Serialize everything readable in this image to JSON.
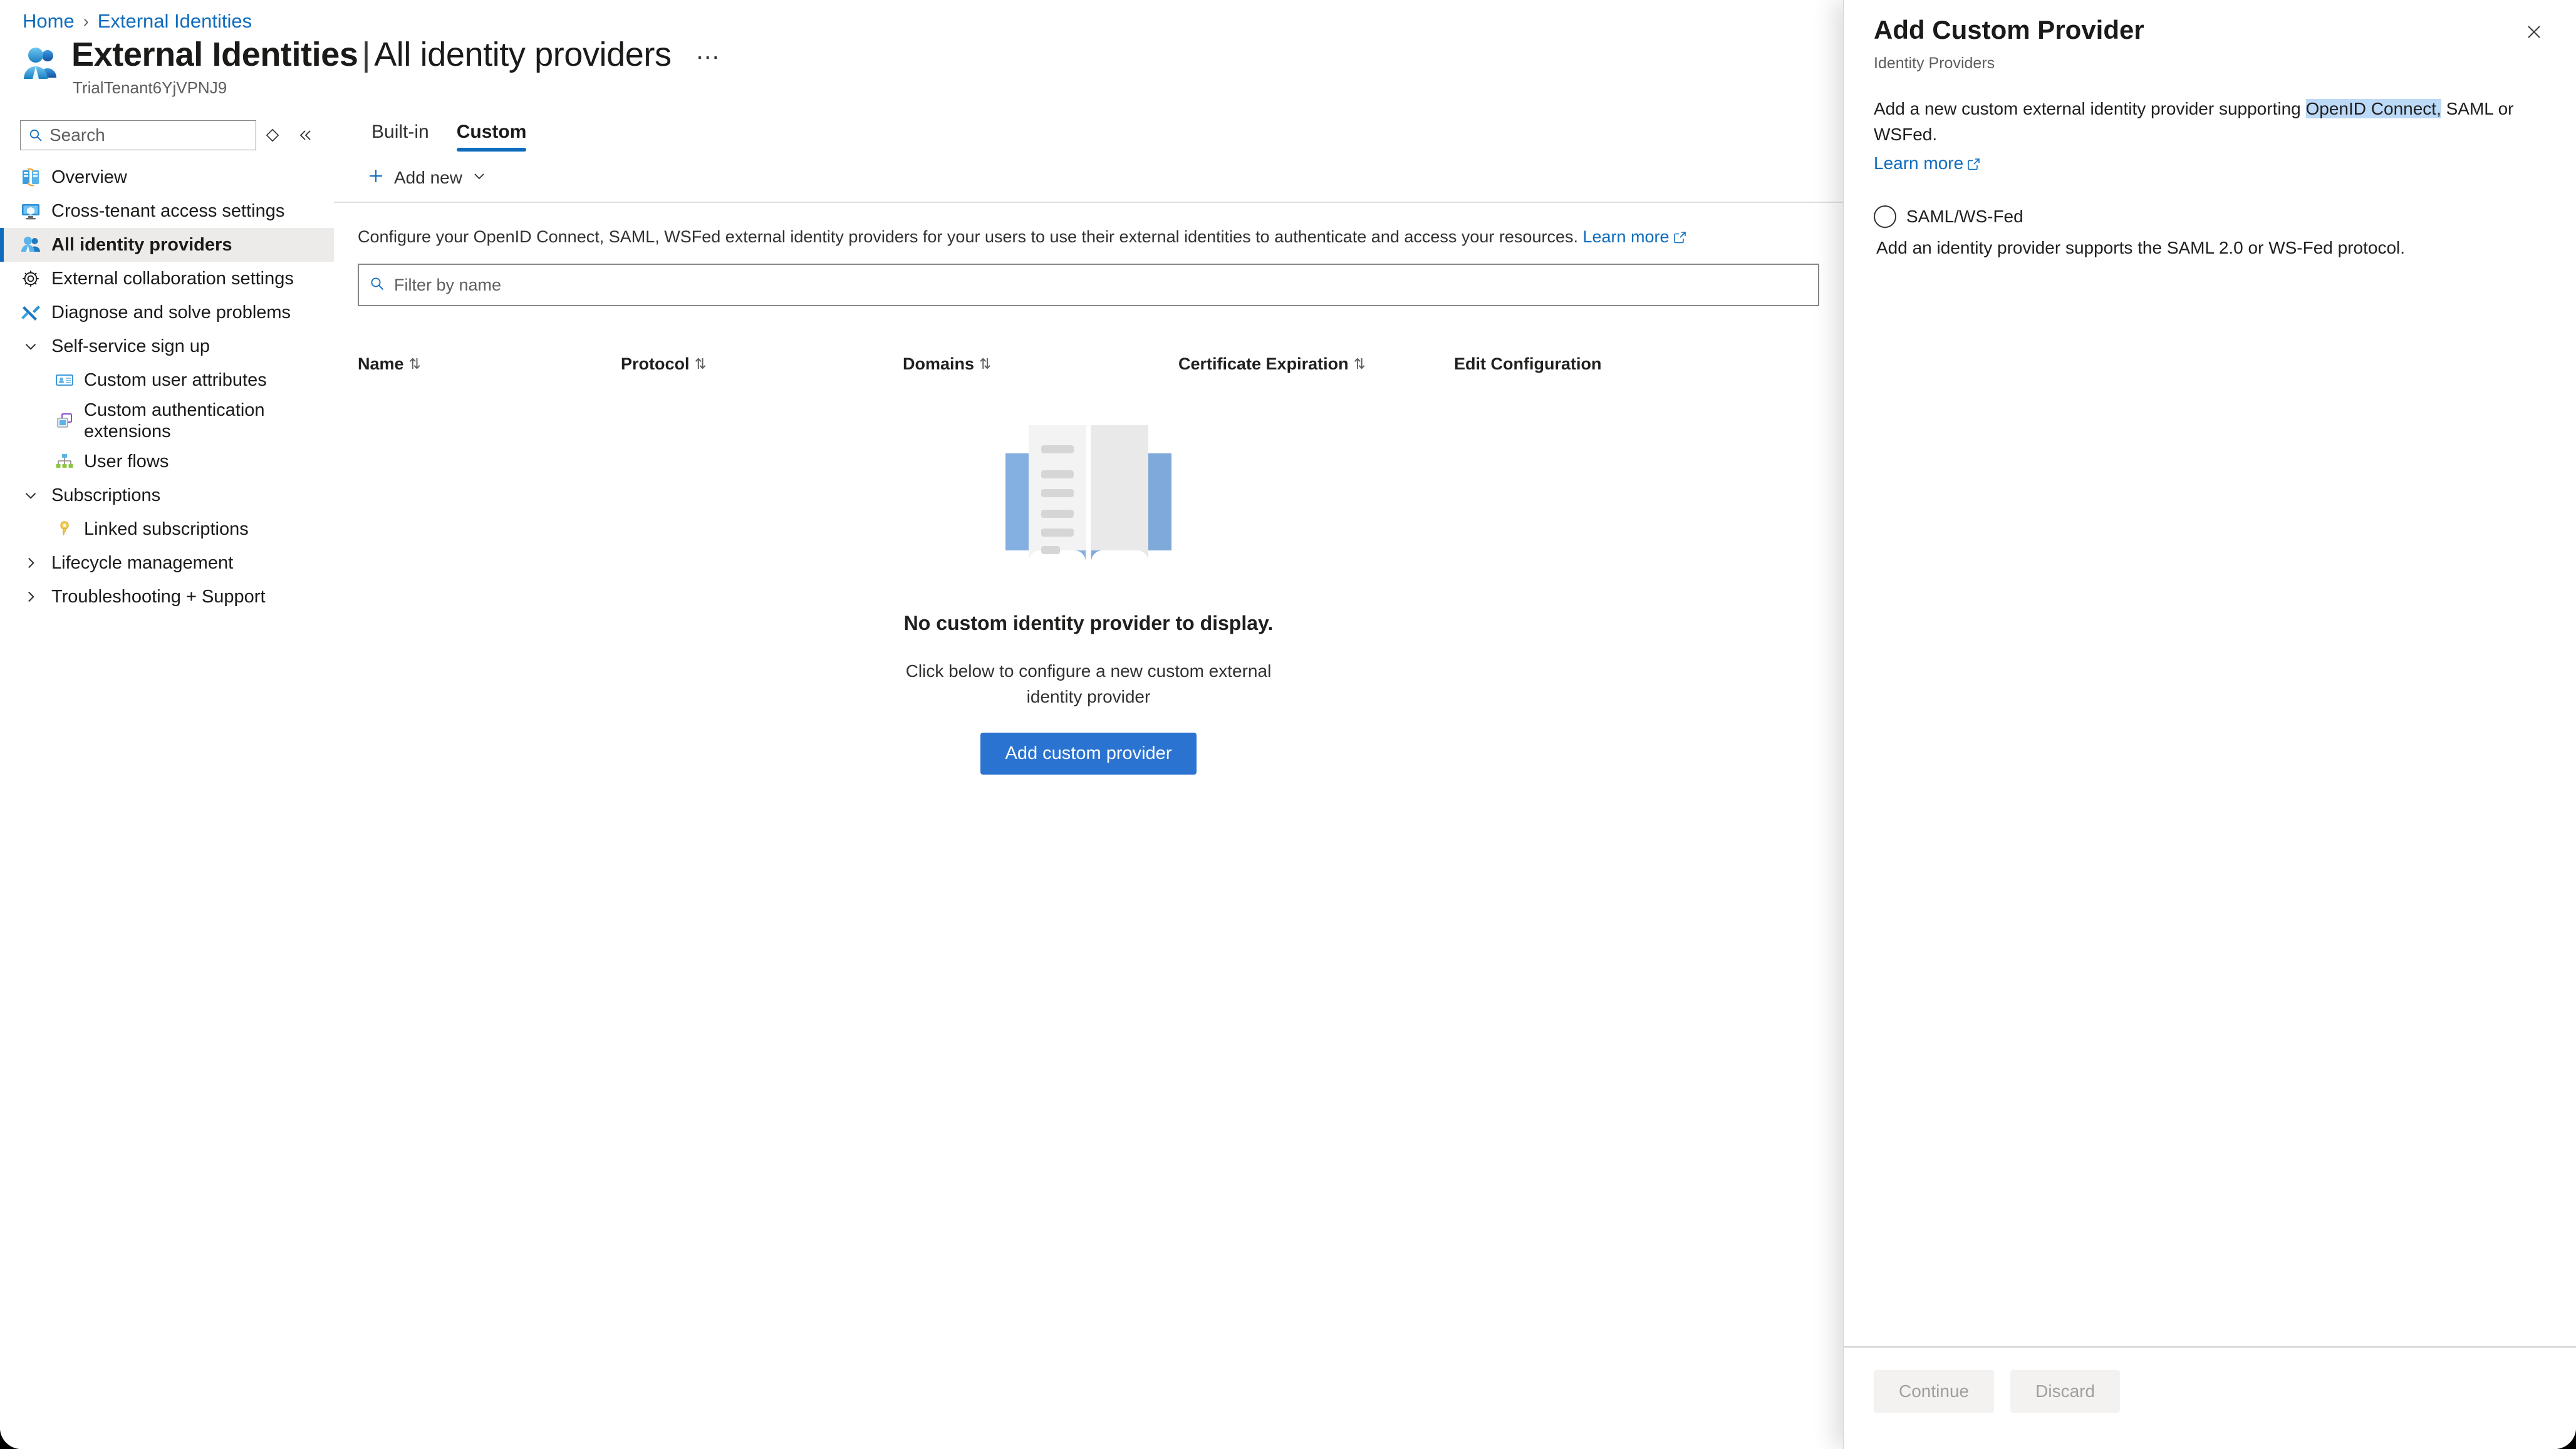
{
  "breadcrumb": {
    "home": "Home",
    "separator": "›",
    "current": "External Identities"
  },
  "header": {
    "icon": "external-identities-icon",
    "title_main": "External Identities",
    "title_divider": "|",
    "title_sub": "All identity providers",
    "more_label": "…",
    "tenant": "TrialTenant6YjVPNJ9"
  },
  "sidebar": {
    "search_placeholder": "Search",
    "search_value": "",
    "diamond_icon": "pin-diamond-icon",
    "collapse_icon": "collapse-double-chevron-icon",
    "items": [
      {
        "label": "Overview",
        "icon": "overview-icon",
        "level": 0,
        "selected": false
      },
      {
        "label": "Cross-tenant access settings",
        "icon": "monitor-icon",
        "level": 0,
        "selected": false
      },
      {
        "label": "All identity providers",
        "icon": "identity-providers-icon",
        "level": 0,
        "selected": true
      },
      {
        "label": "External collaboration settings",
        "icon": "gear-icon",
        "level": 0,
        "selected": false
      },
      {
        "label": "Diagnose and solve problems",
        "icon": "wrench-screwdriver-icon",
        "level": 0,
        "selected": false
      },
      {
        "label": "Self-service sign up",
        "icon": "chevron-down-icon",
        "level": 0,
        "selected": false,
        "group": true,
        "expanded": true
      },
      {
        "label": "Custom user attributes",
        "icon": "user-attributes-icon",
        "level": 1,
        "selected": false
      },
      {
        "label": "Custom authentication extensions",
        "icon": "extension-icon",
        "level": 1,
        "selected": false
      },
      {
        "label": "User flows",
        "icon": "user-flows-icon",
        "level": 1,
        "selected": false
      },
      {
        "label": "Subscriptions",
        "icon": "chevron-down-icon",
        "level": 0,
        "selected": false,
        "group": true,
        "expanded": true
      },
      {
        "label": "Linked subscriptions",
        "icon": "key-icon",
        "level": 1,
        "selected": false
      },
      {
        "label": "Lifecycle management",
        "icon": "chevron-right-icon",
        "level": 0,
        "selected": false,
        "group": true,
        "expanded": false
      },
      {
        "label": "Troubleshooting + Support",
        "icon": "chevron-right-icon",
        "level": 0,
        "selected": false,
        "group": true,
        "expanded": false
      }
    ]
  },
  "main": {
    "tabs": [
      {
        "label": "Built-in",
        "active": false
      },
      {
        "label": "Custom",
        "active": true
      }
    ],
    "toolbar": {
      "add_new_label": "Add new",
      "plus_icon": "plus-icon",
      "chevron_icon": "chevron-down-icon"
    },
    "description": "Configure your OpenID Connect, SAML, WSFed external identity providers for your users to use their external identities to authenticate and access your resources.",
    "description_link": "Learn more",
    "filter_placeholder": "Filter by name",
    "filter_value": "",
    "columns": [
      {
        "label": "Name",
        "sortable": true
      },
      {
        "label": "Protocol",
        "sortable": true
      },
      {
        "label": "Domains",
        "sortable": true
      },
      {
        "label": "Certificate Expiration",
        "sortable": true
      },
      {
        "label": "Edit Configuration",
        "sortable": false
      }
    ],
    "sort_glyph": "⇅",
    "empty_state": {
      "illustration": "open-book-icon",
      "title": "No custom identity provider to display.",
      "subtitle": "Click below to configure a new custom external identity provider",
      "button_label": "Add custom provider"
    }
  },
  "panel": {
    "title": "Add Custom Provider",
    "subtitle": "Identity Providers",
    "close_icon": "close-icon",
    "description_before": "Add a new custom external identity provider supporting ",
    "description_selected": "OpenID Connect,",
    "description_after": " SAML or WSFed.",
    "learn_more": "Learn more",
    "options": [
      {
        "label": "SAML/WS-Fed",
        "description": "Add an identity provider supports the SAML 2.0 or WS-Fed protocol.",
        "checked": false
      }
    ],
    "footer": {
      "continue_label": "Continue",
      "discard_label": "Discard",
      "continue_enabled": false,
      "discard_enabled": false
    }
  },
  "colors": {
    "accent": "#0f6cbd",
    "primary_button": "#2a73d0",
    "selection_highlight": "#bcd9f7",
    "sidebar_selected": "#edebe9"
  }
}
